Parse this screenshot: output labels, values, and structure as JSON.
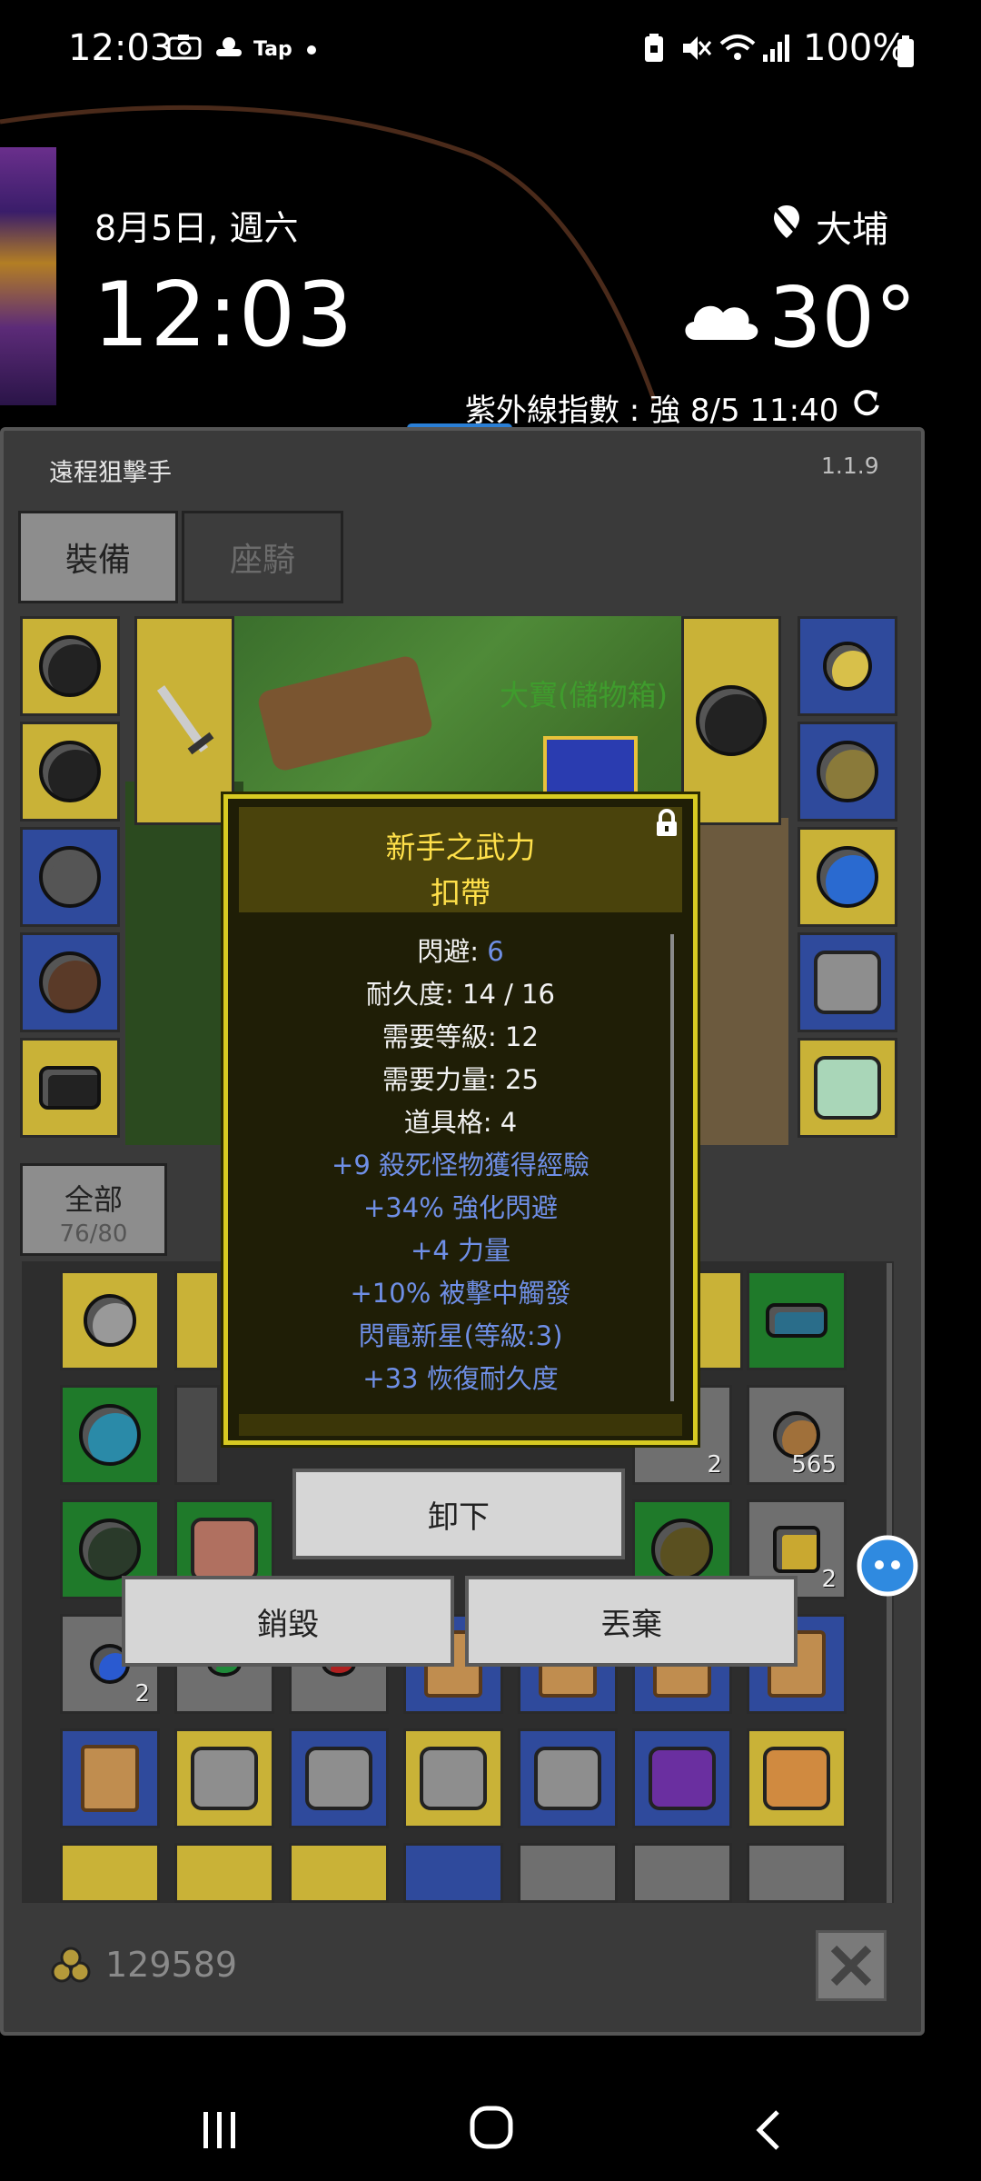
{
  "status_bar": {
    "time": "12:03",
    "notification_icons": [
      "camera-icon",
      "weather-icon",
      "tap-icon",
      "dot-icon"
    ],
    "tap_label": "Tap",
    "system_icons": [
      "battery-saver-icon",
      "mute-icon",
      "wifi-icon",
      "signal-icon"
    ],
    "battery_text": "100%"
  },
  "lockscreen": {
    "date": "8月5日, 週六",
    "clock": "12:03",
    "location": "大埔",
    "temperature": "30°",
    "uv_text": "紫外線指數 : 強    8/5 11:40"
  },
  "game": {
    "title": "遠程狙擊手",
    "version": "1.1.9",
    "tabs": {
      "equip": "裝備",
      "mount": "座騎"
    },
    "scene_label": "大寶(儲物箱)",
    "filter": {
      "label": "全部",
      "count": "76/80"
    },
    "inventory_quantities": {
      "slot_1_6": "2",
      "slot_1_7": "565",
      "slot_2_7": "2",
      "slot_3_1": "2"
    },
    "gold": "129589"
  },
  "tooltip": {
    "name": "新手之武力",
    "type": "扣帶",
    "stats": [
      {
        "label": "閃避: ",
        "value": "6"
      },
      {
        "label": "耐久度: 14 / 16"
      },
      {
        "label": "需要等級: 12"
      },
      {
        "label": "需要力量: 25"
      },
      {
        "label": "道具格: 4"
      }
    ],
    "bonuses": [
      "+9 殺死怪物獲得經驗",
      "+34% 強化閃避",
      "+4 力量",
      "+10% 被擊中觸發",
      "閃電新星(等級:3)",
      "+33 恢復耐久度"
    ],
    "colors": {
      "bonus": "#6f8fe6",
      "title": "#ffe04a",
      "border": "#d8cb22"
    }
  },
  "actions": {
    "unequip": "卸下",
    "destroy": "銷毀",
    "drop": "丟棄"
  }
}
